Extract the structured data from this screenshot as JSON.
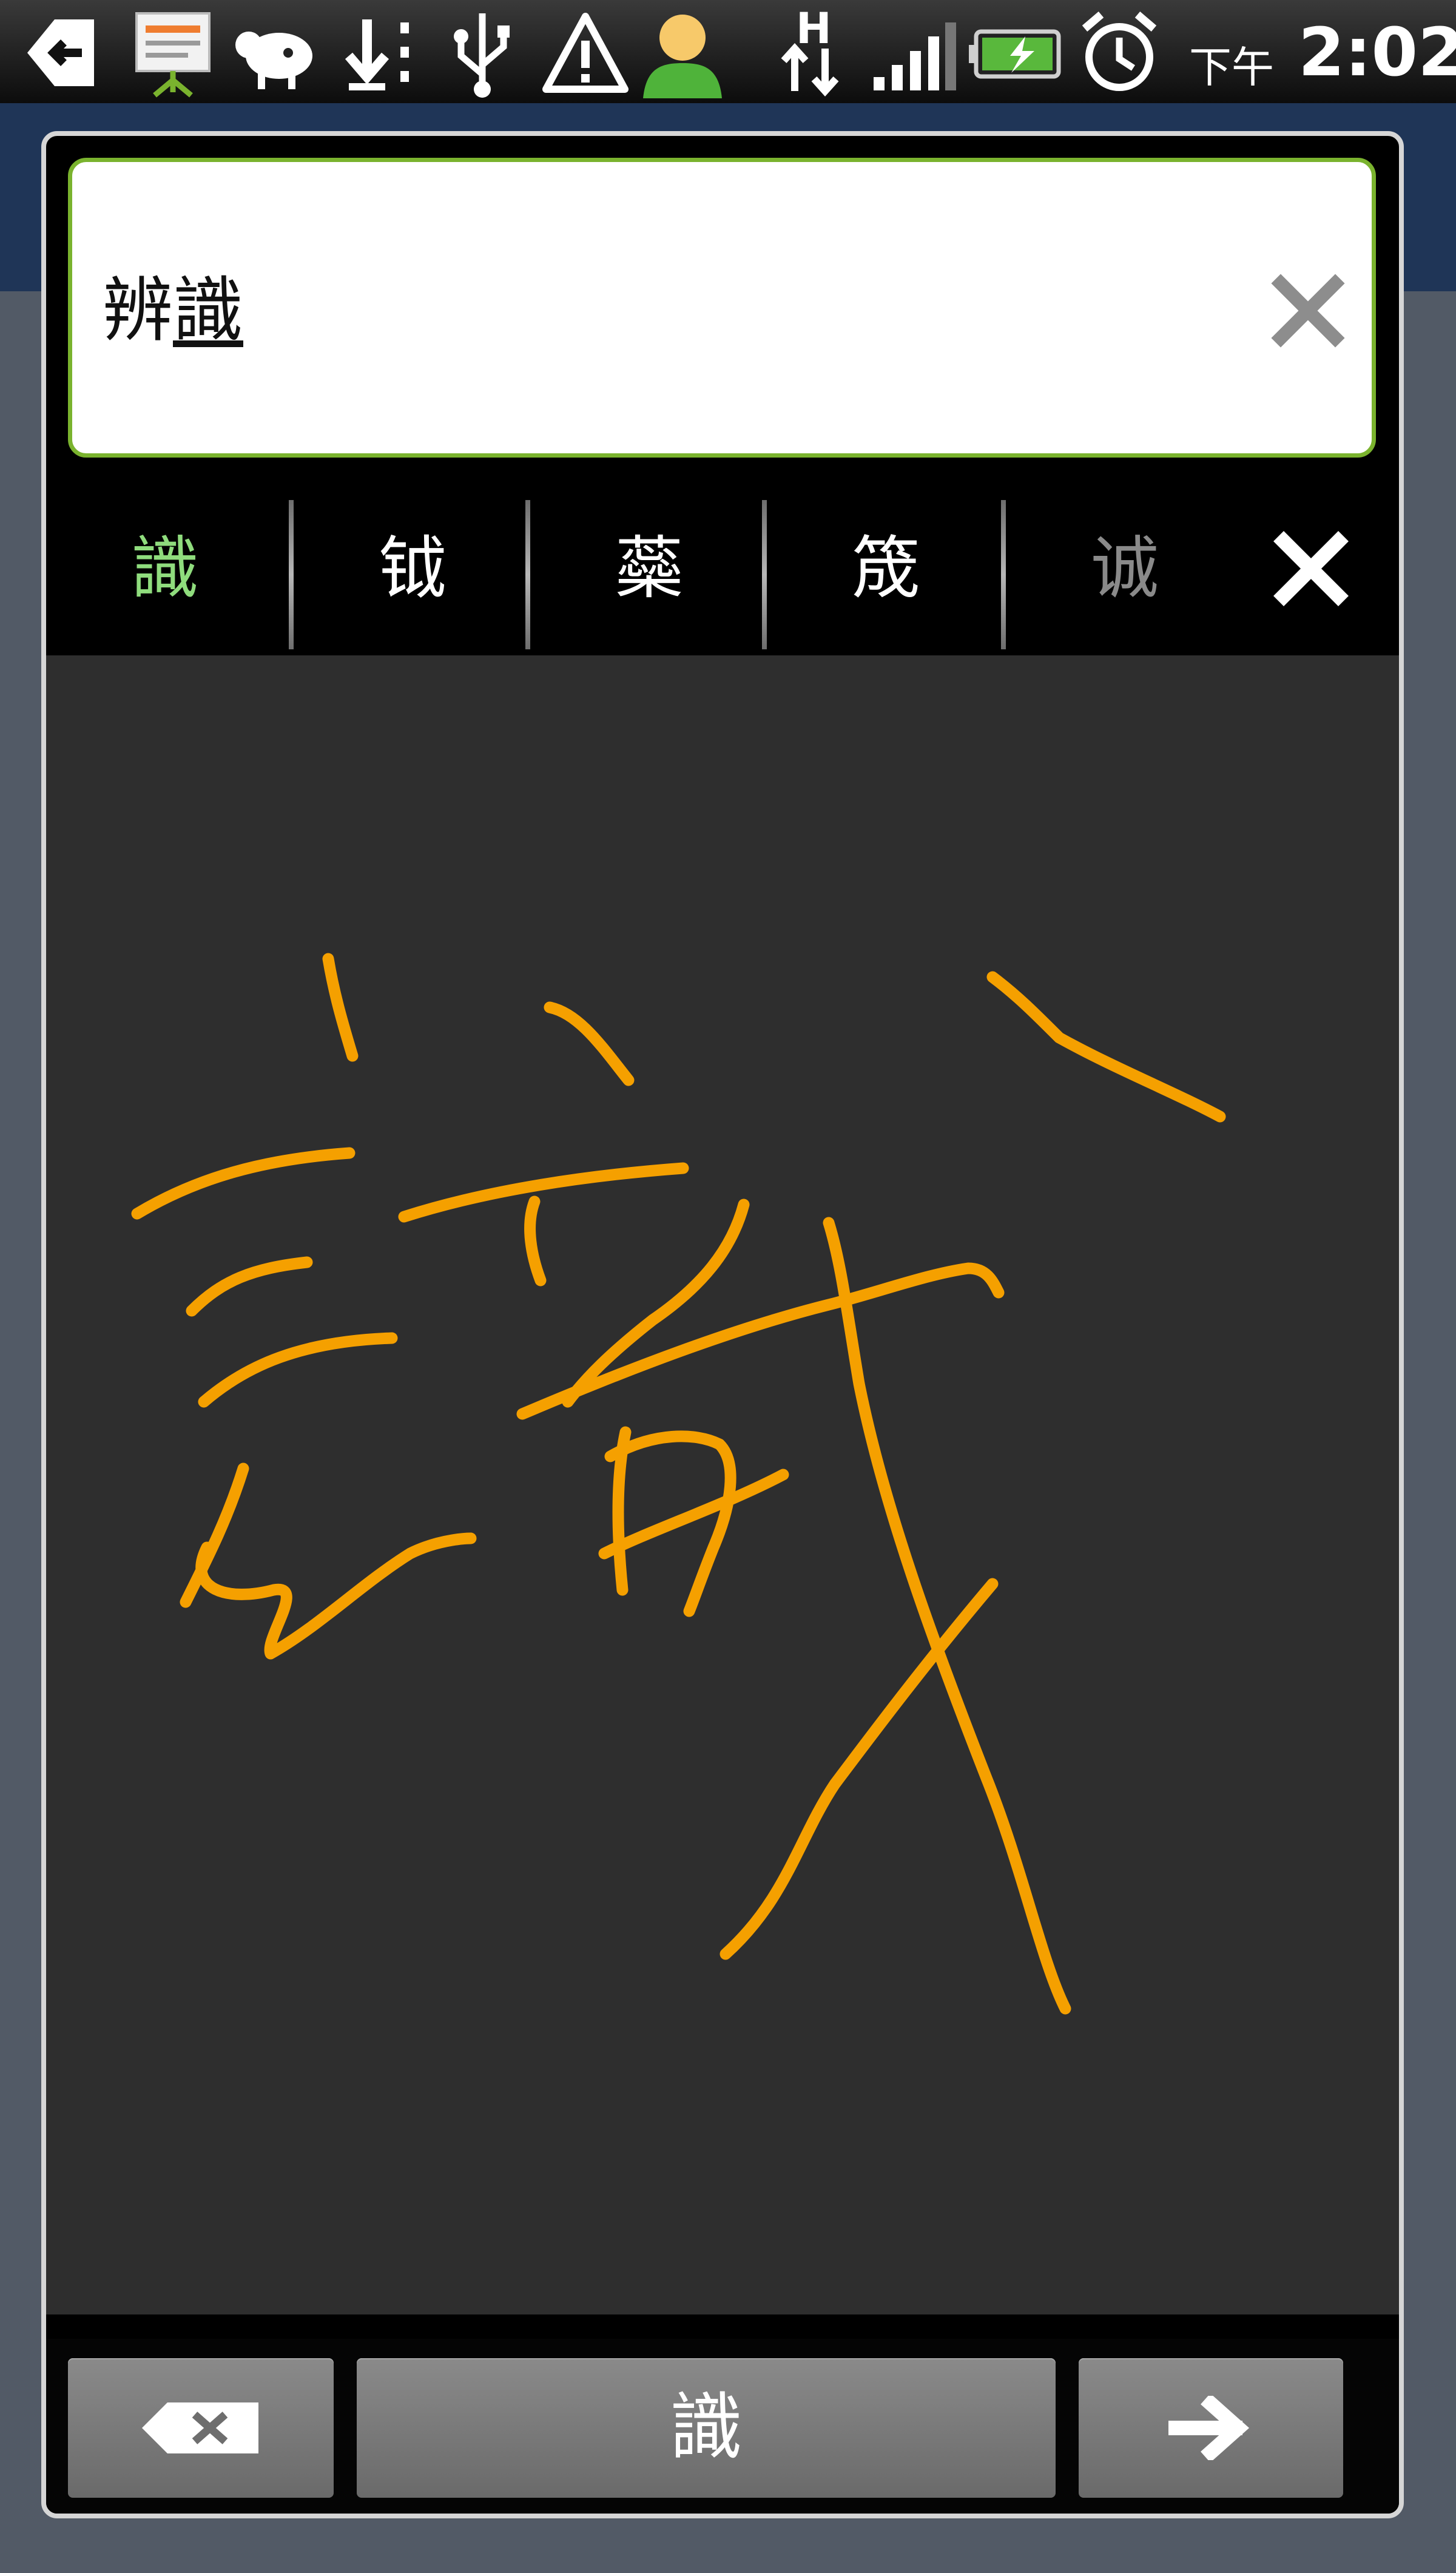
{
  "status_bar": {
    "icons": [
      "back-icon",
      "presentation-icon",
      "animal-icon",
      "download-icon",
      "usb-icon",
      "warning-icon",
      "user-icon",
      "h-data-icon",
      "signal-icon",
      "battery-icon",
      "alarm-icon"
    ],
    "network_label": "H",
    "ampm": "下午",
    "time": "2:02"
  },
  "input": {
    "committed_text": "辨",
    "composing_text": "識",
    "clear_icon": "clear-x-icon"
  },
  "candidates": [
    {
      "text": "識",
      "state": "selected"
    },
    {
      "text": "钺",
      "state": "normal"
    },
    {
      "text": "蘂",
      "state": "normal"
    },
    {
      "text": "筬",
      "state": "normal"
    },
    {
      "text": "诚",
      "state": "dim"
    }
  ],
  "candidate_close_icon": "close-icon",
  "handwriting": {
    "ink_color": "#f5a000",
    "pad_color": "#2e2e2e"
  },
  "keys": {
    "backspace_icon": "backspace-icon",
    "commit_label": "識",
    "enter_icon": "arrow-right-icon"
  },
  "colors": {
    "accent_green": "#7ab32e",
    "selected_candidate": "#8fdc7d"
  }
}
